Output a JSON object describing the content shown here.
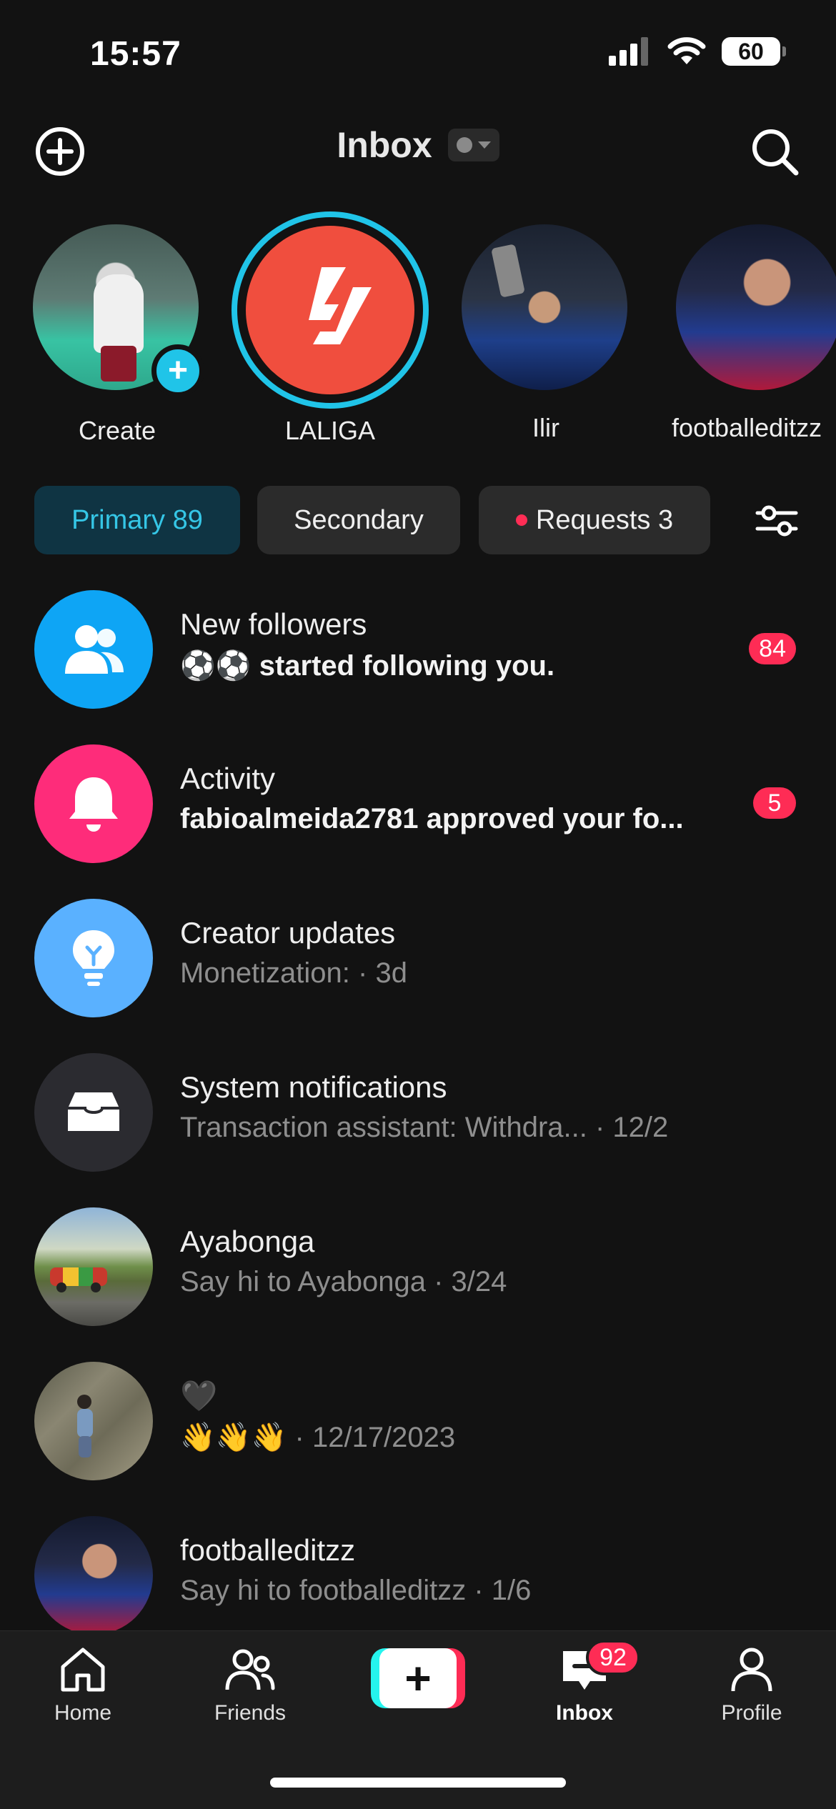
{
  "status_bar": {
    "time": "15:57",
    "battery": "60"
  },
  "header": {
    "title": "Inbox"
  },
  "stories": [
    {
      "label": "Create"
    },
    {
      "label": "LALIGA"
    },
    {
      "label": "Ilir"
    },
    {
      "label": "footballeditzz"
    }
  ],
  "filters": {
    "primary": "Primary 89",
    "secondary": "Secondary",
    "requests": "Requests 3"
  },
  "inbox": [
    {
      "title": "New followers",
      "subtitle": "⚽⚽ started following you.",
      "badge": "84",
      "icon": "followers-icon",
      "color": "#0ea5f5"
    },
    {
      "title": "Activity",
      "subtitle": "fabioalmeida2781 approved your fo...",
      "badge": "5",
      "icon": "bell-icon",
      "color": "#fe2c7a"
    },
    {
      "title": "Creator updates",
      "subtitle": "Monetization:  · 3d",
      "icon": "lightbulb-icon",
      "color": "#5ab1ff"
    },
    {
      "title": "System notifications",
      "subtitle": "Transaction assistant: Withdra... · 12/2",
      "icon": "inbox-tray-icon",
      "color": "#2b2b30"
    },
    {
      "title": "Ayabonga",
      "subtitle": "Say hi to Ayabonga · 3/24"
    },
    {
      "title": "🖤",
      "subtitle": "👋👋👋 · 12/17/2023"
    },
    {
      "title": "footballeditzz",
      "subtitle": "Say hi to footballeditzz · 1/6"
    }
  ],
  "bottom_nav": {
    "home": "Home",
    "friends": "Friends",
    "inbox": "Inbox",
    "inbox_badge": "92",
    "profile": "Profile"
  }
}
